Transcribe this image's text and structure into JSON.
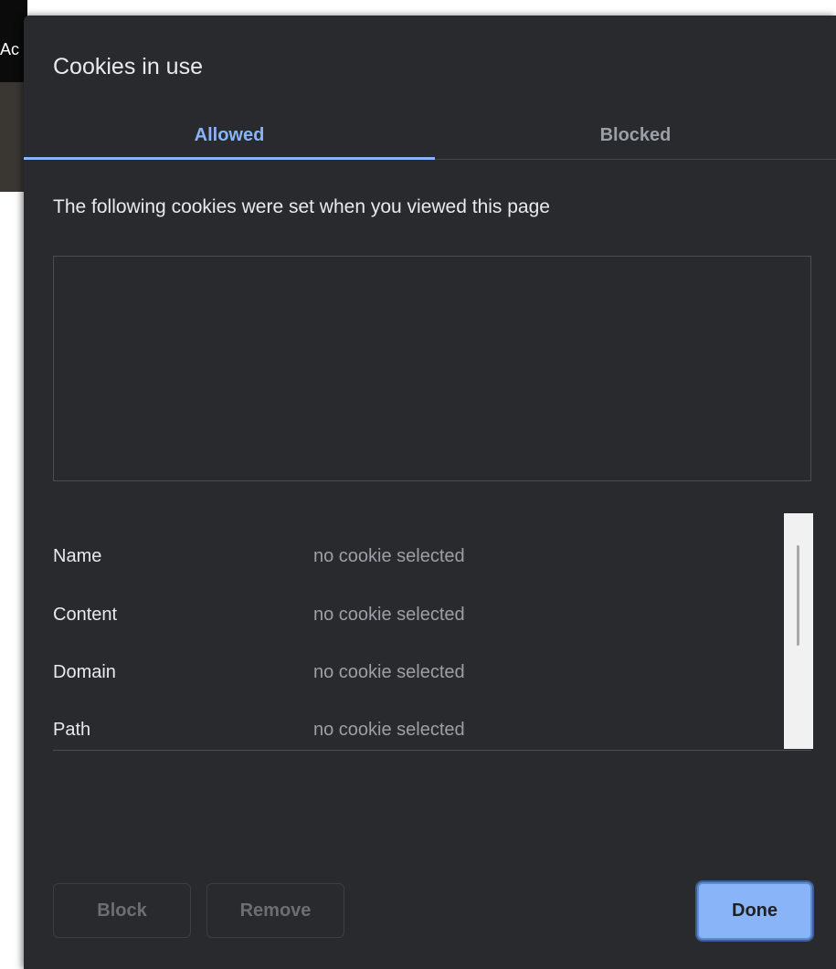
{
  "background": {
    "partial_text": "Ac"
  },
  "dialog": {
    "title": "Cookies in use",
    "tabs": [
      {
        "label": "Allowed",
        "selected": true
      },
      {
        "label": "Blocked",
        "selected": false
      }
    ],
    "description": "The following cookies were set when you viewed this page",
    "details": [
      {
        "label": "Name",
        "value": "no cookie selected"
      },
      {
        "label": "Content",
        "value": "no cookie selected"
      },
      {
        "label": "Domain",
        "value": "no cookie selected"
      },
      {
        "label": "Path",
        "value": "no cookie selected"
      }
    ],
    "buttons": {
      "block": "Block",
      "remove": "Remove",
      "done": "Done"
    }
  },
  "colors": {
    "dialog_bg": "#292a2d",
    "accent": "#8ab4f8",
    "text_primary": "#e8eaed",
    "text_secondary": "#9aa0a6"
  }
}
